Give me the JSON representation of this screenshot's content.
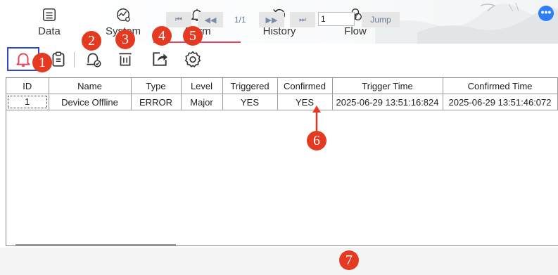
{
  "nav": {
    "items": [
      {
        "label": "Data",
        "icon": "list-doc-icon"
      },
      {
        "label": "System",
        "icon": "chart-circle-icon"
      },
      {
        "label": "Alarm",
        "icon": "bell-icon"
      },
      {
        "label": "History",
        "icon": "clock-history-icon"
      },
      {
        "label": "Flow",
        "icon": "flow-knot-icon"
      }
    ],
    "active": "Alarm",
    "more_label": "•••"
  },
  "markers": [
    "1",
    "2",
    "3",
    "4",
    "5",
    "6",
    "7"
  ],
  "table": {
    "columns": [
      "ID",
      "Name",
      "Type",
      "Level",
      "Triggered",
      "Confirmed",
      "Trigger Time",
      "Confirmed Time"
    ],
    "rows": [
      [
        "1",
        "Device Offline",
        "ERROR",
        "Major",
        "YES",
        "YES",
        "2025-06-29 13:51:16:824",
        "2025-06-29 13:51:46:072"
      ]
    ]
  },
  "pager": {
    "first": "⏮",
    "prev": "◀◀",
    "page_info": "1/1",
    "next": "▶▶",
    "last": "⏭",
    "jump_value": "1",
    "jump_label": "Jump"
  },
  "colors": {
    "accent_red": "#e8425b",
    "marker": "#e43a22",
    "selection_blue": "#2c47d6"
  }
}
